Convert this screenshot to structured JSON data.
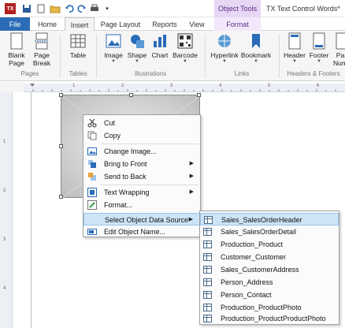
{
  "titlebar": {
    "logo_text": "TX",
    "object_tools_label": "Object Tools",
    "window_title": "TX Text Control Words*"
  },
  "tabs": {
    "file": "File",
    "home": "Home",
    "insert": "Insert",
    "page_layout": "Page Layout",
    "reports": "Reports",
    "view": "View",
    "format": "Format"
  },
  "ribbon": {
    "blank_page": "Blank Page",
    "page_break": "Page Break",
    "table": "Table",
    "image": "Image",
    "shape": "Shape",
    "chart": "Chart",
    "barcode": "Barcode",
    "hyperlink": "Hyperlink",
    "bookmark": "Bookmark",
    "header": "Header",
    "footer": "Footer",
    "page_number_partial": "Pa",
    "page_number_partial2": "Num",
    "groups": {
      "pages": "Pages",
      "tables": "Tables",
      "illustrations": "Illustrations",
      "links": "Links",
      "headers_footers": "Headers & Footers"
    }
  },
  "context_menu": {
    "cut": "Cut",
    "copy": "Copy",
    "change_image": "Change Image...",
    "bring_to_front": "Bring to Front",
    "send_to_back": "Send to Back",
    "text_wrapping": "Text Wrapping",
    "format": "Format...",
    "select_object_data_source": "Select Object Data Source",
    "edit_object_name": "Edit Object Name..."
  },
  "submenu": {
    "items": [
      "Sales_SalesOrderHeader",
      "Sales_SalesOrderDetail",
      "Production_Product",
      "Customer_Customer",
      "Sales_CustomerAddress",
      "Person_Address",
      "Person_Contact",
      "Production_ProductPhoto",
      "Production_ProductProductPhoto"
    ]
  },
  "ruler": {
    "h_marks": [
      "1",
      "2",
      "3",
      "4",
      "5",
      "6"
    ],
    "v_marks": [
      "1",
      "2",
      "3",
      "4"
    ]
  }
}
